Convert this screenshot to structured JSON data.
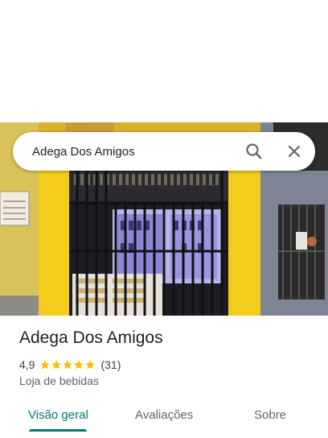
{
  "search": {
    "query": "Adega Dos Amigos",
    "placeholder": ""
  },
  "place": {
    "name": "Adega Dos Amigos",
    "rating": "4,9",
    "stars": 5,
    "reviews": "(31)",
    "category": "Loja de bebidas"
  },
  "tabs": [
    {
      "label": "Visão geral",
      "active": true
    },
    {
      "label": "Avaliações",
      "active": false
    },
    {
      "label": "Sobre",
      "active": false
    }
  ],
  "colors": {
    "accent": "#00796b",
    "star": "#fbbc04",
    "text": "#202124",
    "secondary": "#5f6368"
  }
}
